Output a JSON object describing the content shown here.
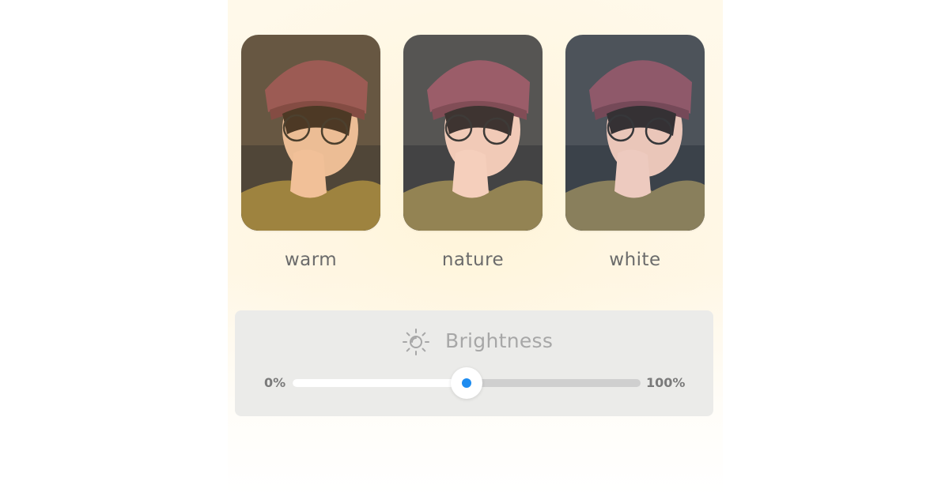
{
  "presets": [
    {
      "label": "warm",
      "selected": false
    },
    {
      "label": "nature",
      "selected": true
    },
    {
      "label": "white",
      "selected": false
    }
  ],
  "brightness": {
    "title": "Brightness",
    "icon": "sun-icon",
    "min_label": "0%",
    "max_label": "100%",
    "value_percent": 50,
    "accent_color": "#1e8cf0"
  }
}
